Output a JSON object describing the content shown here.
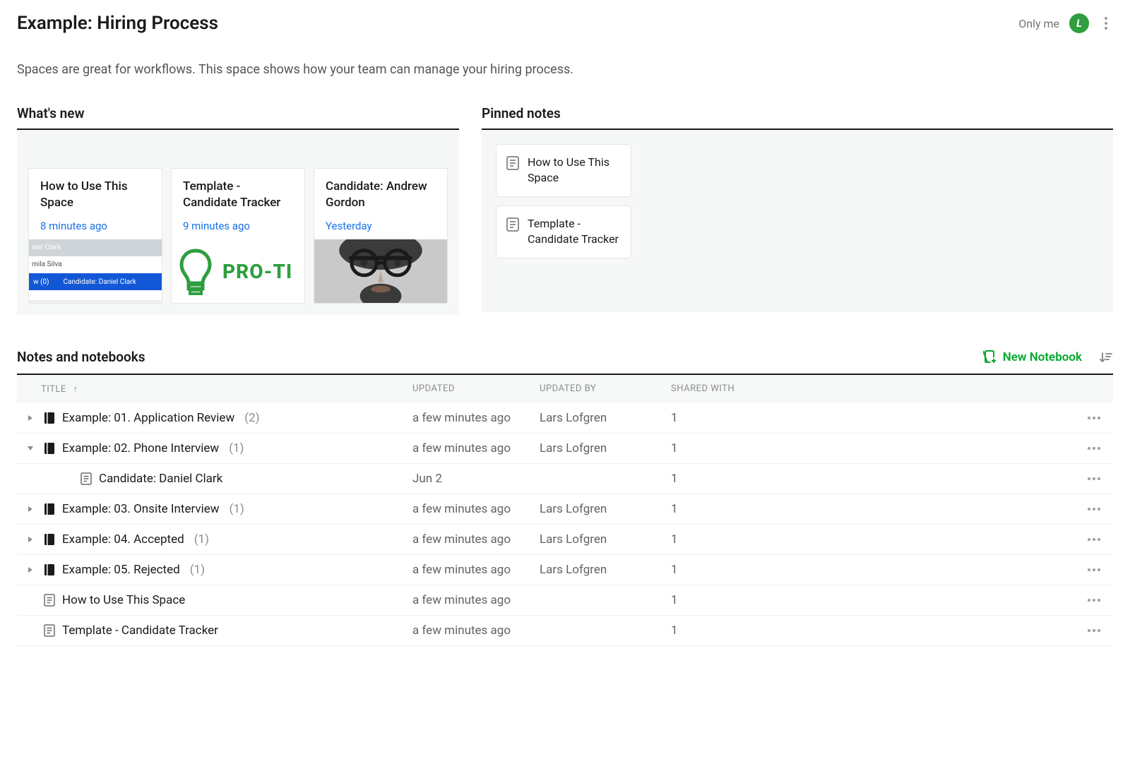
{
  "header": {
    "title": "Example: Hiring Process",
    "share_label": "Only me",
    "avatar_initial": "L"
  },
  "description": "Spaces are great for workflows. This space shows how your team can manage your hiring process.",
  "whats_new": {
    "heading": "What's new",
    "cards": [
      {
        "title": "How to Use This Space",
        "time": "8 minutes ago",
        "preview": {
          "row1": "niel Clark",
          "row2": "mila Silva",
          "bar_label": "w (0)",
          "bar_note": "Candidate: Daniel Clark"
        }
      },
      {
        "title": "Template - Candidate Tracker",
        "time": "9 minutes ago",
        "preview": {
          "protip": "PRO-TI"
        }
      },
      {
        "title": "Candidate: Andrew Gordon",
        "time": "Yesterday"
      }
    ]
  },
  "pinned": {
    "heading": "Pinned notes",
    "items": [
      {
        "title": "How to Use This Space"
      },
      {
        "title": "Template - Candidate Tracker"
      }
    ]
  },
  "notes_section": {
    "heading": "Notes and notebooks",
    "new_notebook_label": "New Notebook",
    "columns": {
      "title": "TITLE",
      "updated": "UPDATED",
      "updated_by": "UPDATED BY",
      "shared_with": "SHARED WITH"
    },
    "rows": [
      {
        "type": "notebook",
        "expanded": false,
        "indent": 0,
        "name": "Example: 01. Application Review",
        "count": "(2)",
        "updated": "a few minutes ago",
        "updated_by": "Lars Lofgren",
        "shared": "1"
      },
      {
        "type": "notebook",
        "expanded": true,
        "indent": 0,
        "name": "Example: 02. Phone Interview",
        "count": "(1)",
        "updated": "a few minutes ago",
        "updated_by": "Lars Lofgren",
        "shared": "1"
      },
      {
        "type": "note",
        "indent": 1,
        "name": "Candidate: Daniel Clark",
        "count": "",
        "updated": "Jun 2",
        "updated_by": "",
        "shared": "1"
      },
      {
        "type": "notebook",
        "expanded": false,
        "indent": 0,
        "name": "Example: 03. Onsite Interview",
        "count": "(1)",
        "updated": "a few minutes ago",
        "updated_by": "Lars Lofgren",
        "shared": "1"
      },
      {
        "type": "notebook",
        "expanded": false,
        "indent": 0,
        "name": "Example: 04. Accepted",
        "count": "(1)",
        "updated": "a few minutes ago",
        "updated_by": "Lars Lofgren",
        "shared": "1"
      },
      {
        "type": "notebook",
        "expanded": false,
        "indent": 0,
        "name": "Example: 05. Rejected",
        "count": "(1)",
        "updated": "a few minutes ago",
        "updated_by": "Lars Lofgren",
        "shared": "1"
      },
      {
        "type": "note",
        "indent": 0,
        "name": "How to Use This Space",
        "count": "",
        "updated": "a few minutes ago",
        "updated_by": "",
        "shared": "1"
      },
      {
        "type": "note",
        "indent": 0,
        "name": "Template - Candidate Tracker",
        "count": "",
        "updated": "a few minutes ago",
        "updated_by": "",
        "shared": "1"
      }
    ]
  }
}
